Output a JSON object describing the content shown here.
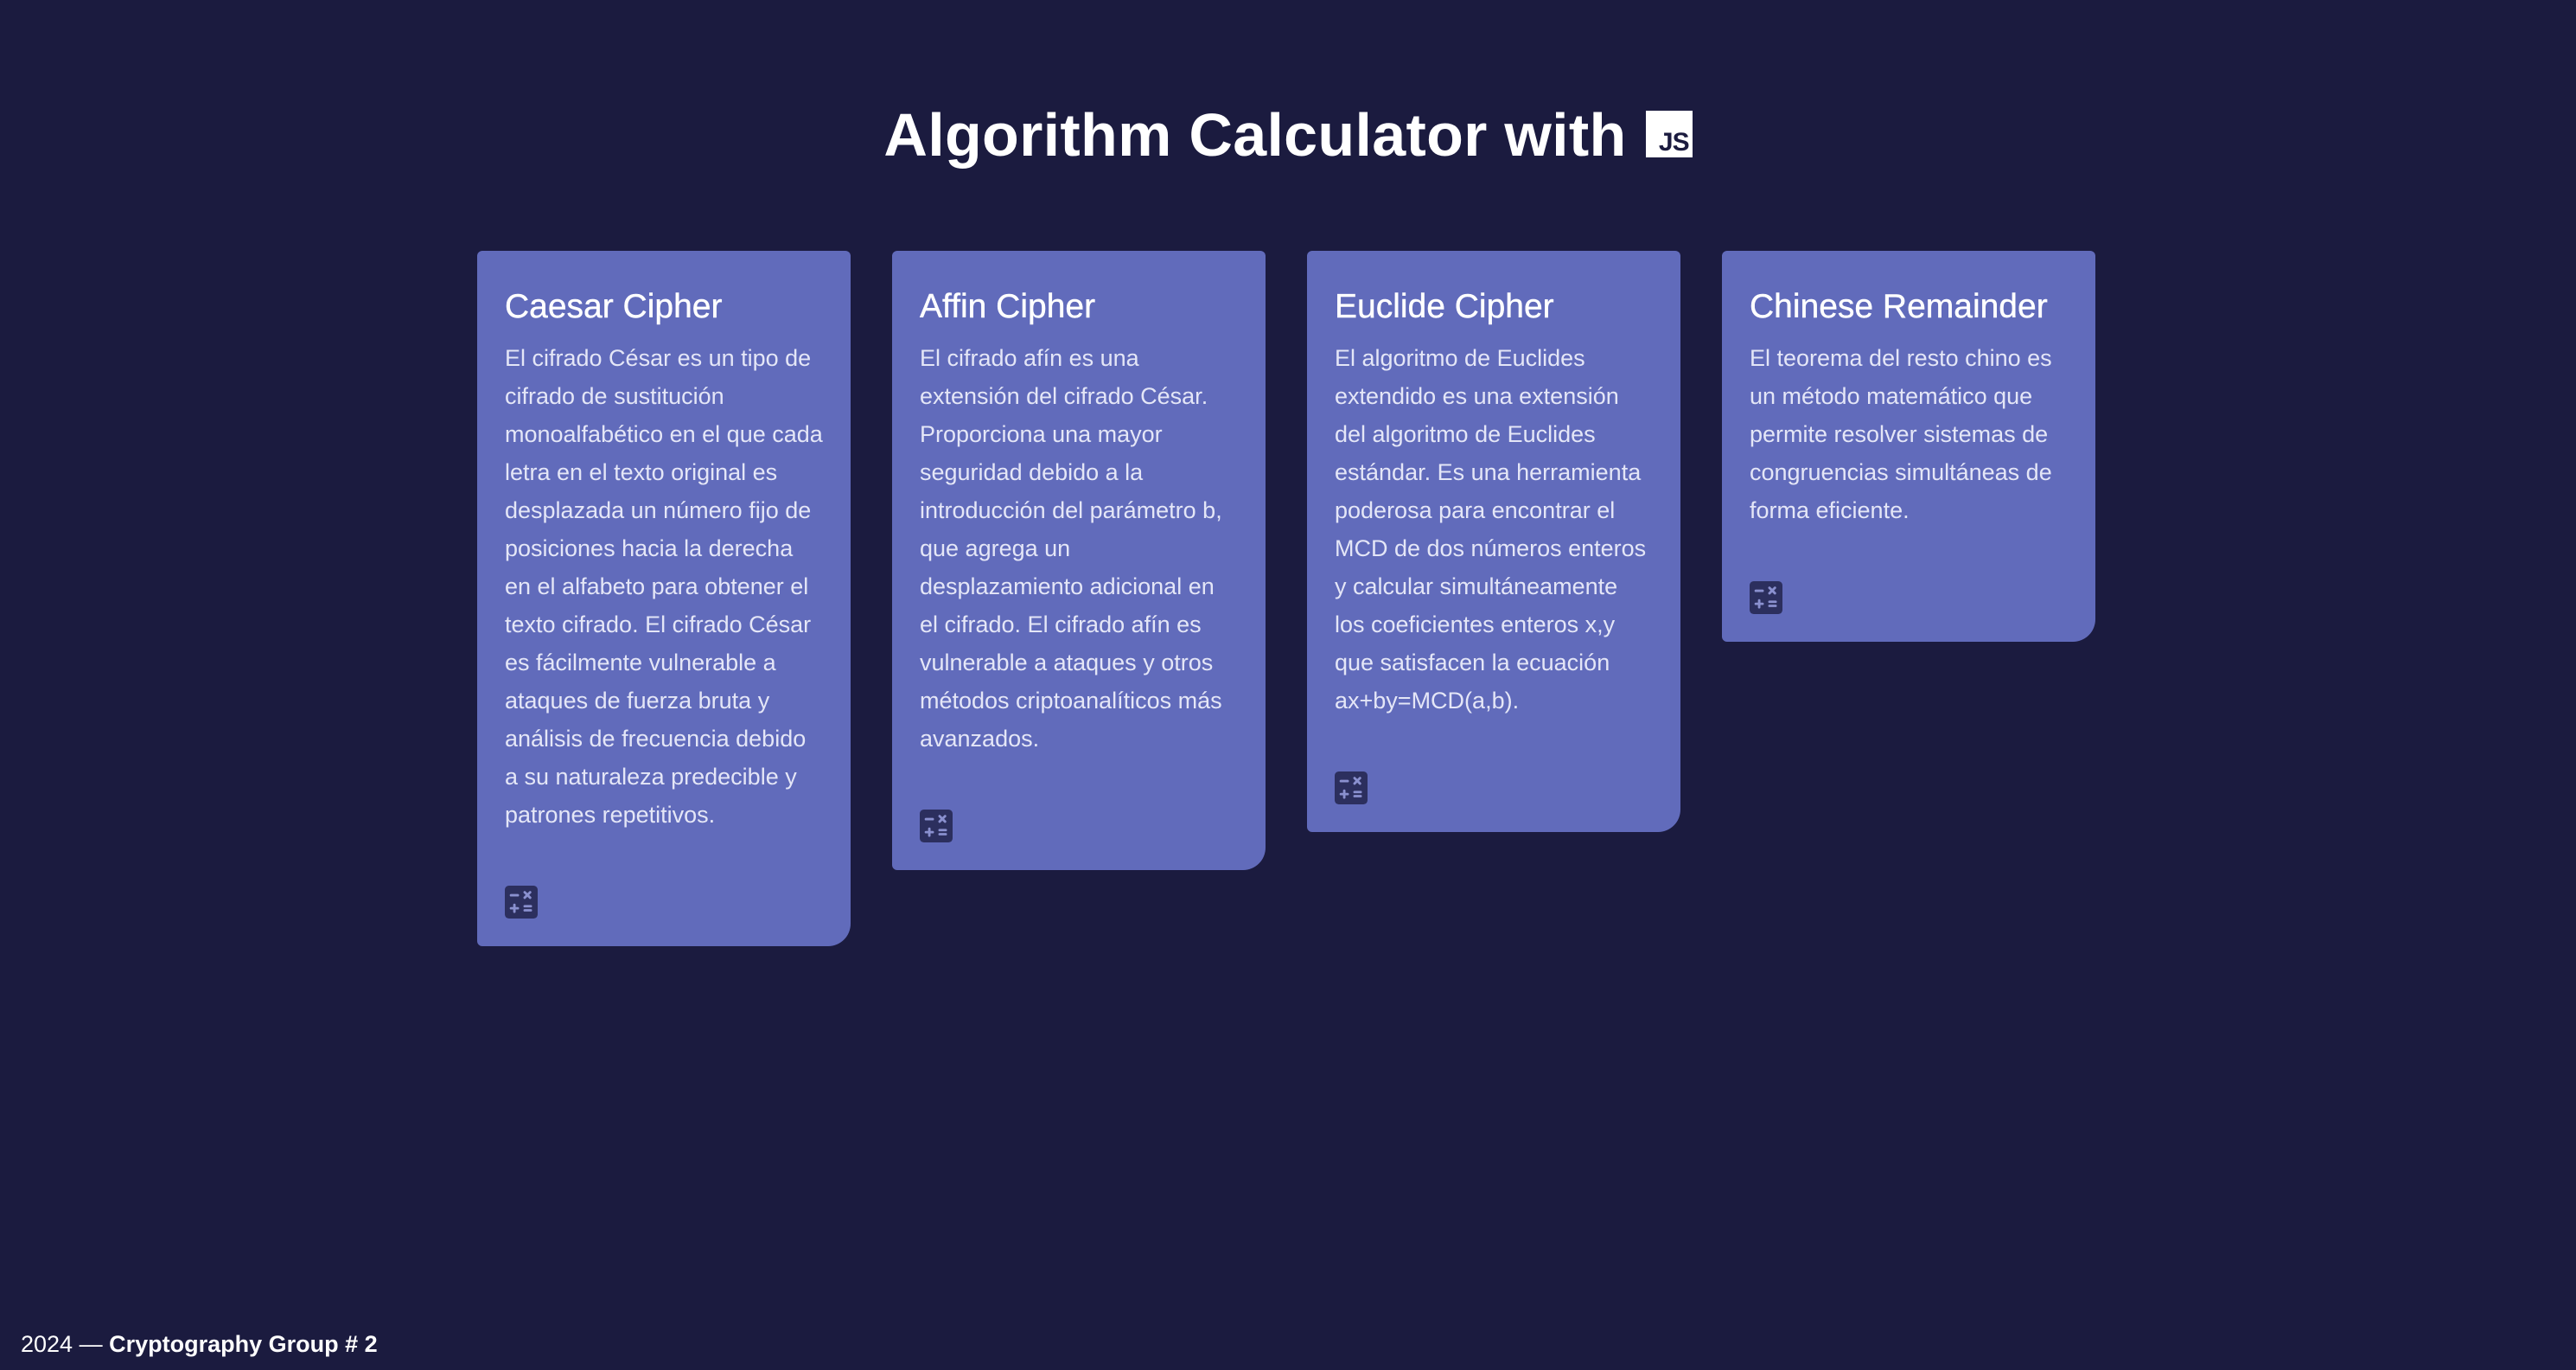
{
  "header": {
    "title": "Algorithm Calculator with",
    "logo_text": "JS"
  },
  "cards": [
    {
      "title": "Caesar Cipher",
      "description": "El cifrado César es un tipo de cifrado de sustitución monoalfabético en el que cada letra en el texto original es desplazada un número fijo de posiciones hacia la derecha en el alfabeto para obtener el texto cifrado. El cifrado César es fácilmente vulnerable a ataques de fuerza bruta y análisis de frecuencia debido a su naturaleza predecible y patrones repetitivos.",
      "icon": "calculator-icon"
    },
    {
      "title": "Affin Cipher",
      "description": "El cifrado afín es una extensión del cifrado César. Proporciona una mayor seguridad debido a la introducción del parámetro b, que agrega un desplazamiento adicional en el cifrado. El cifrado afín es vulnerable a ataques y otros métodos criptoanalíticos más avanzados.",
      "icon": "calculator-icon"
    },
    {
      "title": "Euclide Cipher",
      "description": "El algoritmo de Euclides extendido es una extensión del algoritmo de Euclides estándar. Es una herramienta poderosa para encontrar el MCD de dos números enteros y calcular simultáneamente los coeficientes enteros x,y que satisfacen la ecuación ax+by=MCD(a,b).",
      "icon": "calculator-icon"
    },
    {
      "title": "Chinese Remainder",
      "description": "El teorema del resto chino es un método matemático que permite resolver sistemas de congruencias simultáneas de forma eficiente.",
      "icon": "calculator-icon"
    }
  ],
  "footer": {
    "year_text": "2024 —",
    "group_name": "Cryptography Group # 2"
  },
  "colors": {
    "background": "#1b1b3f",
    "card": "#616bbb",
    "icon": "#2c2f5e"
  }
}
